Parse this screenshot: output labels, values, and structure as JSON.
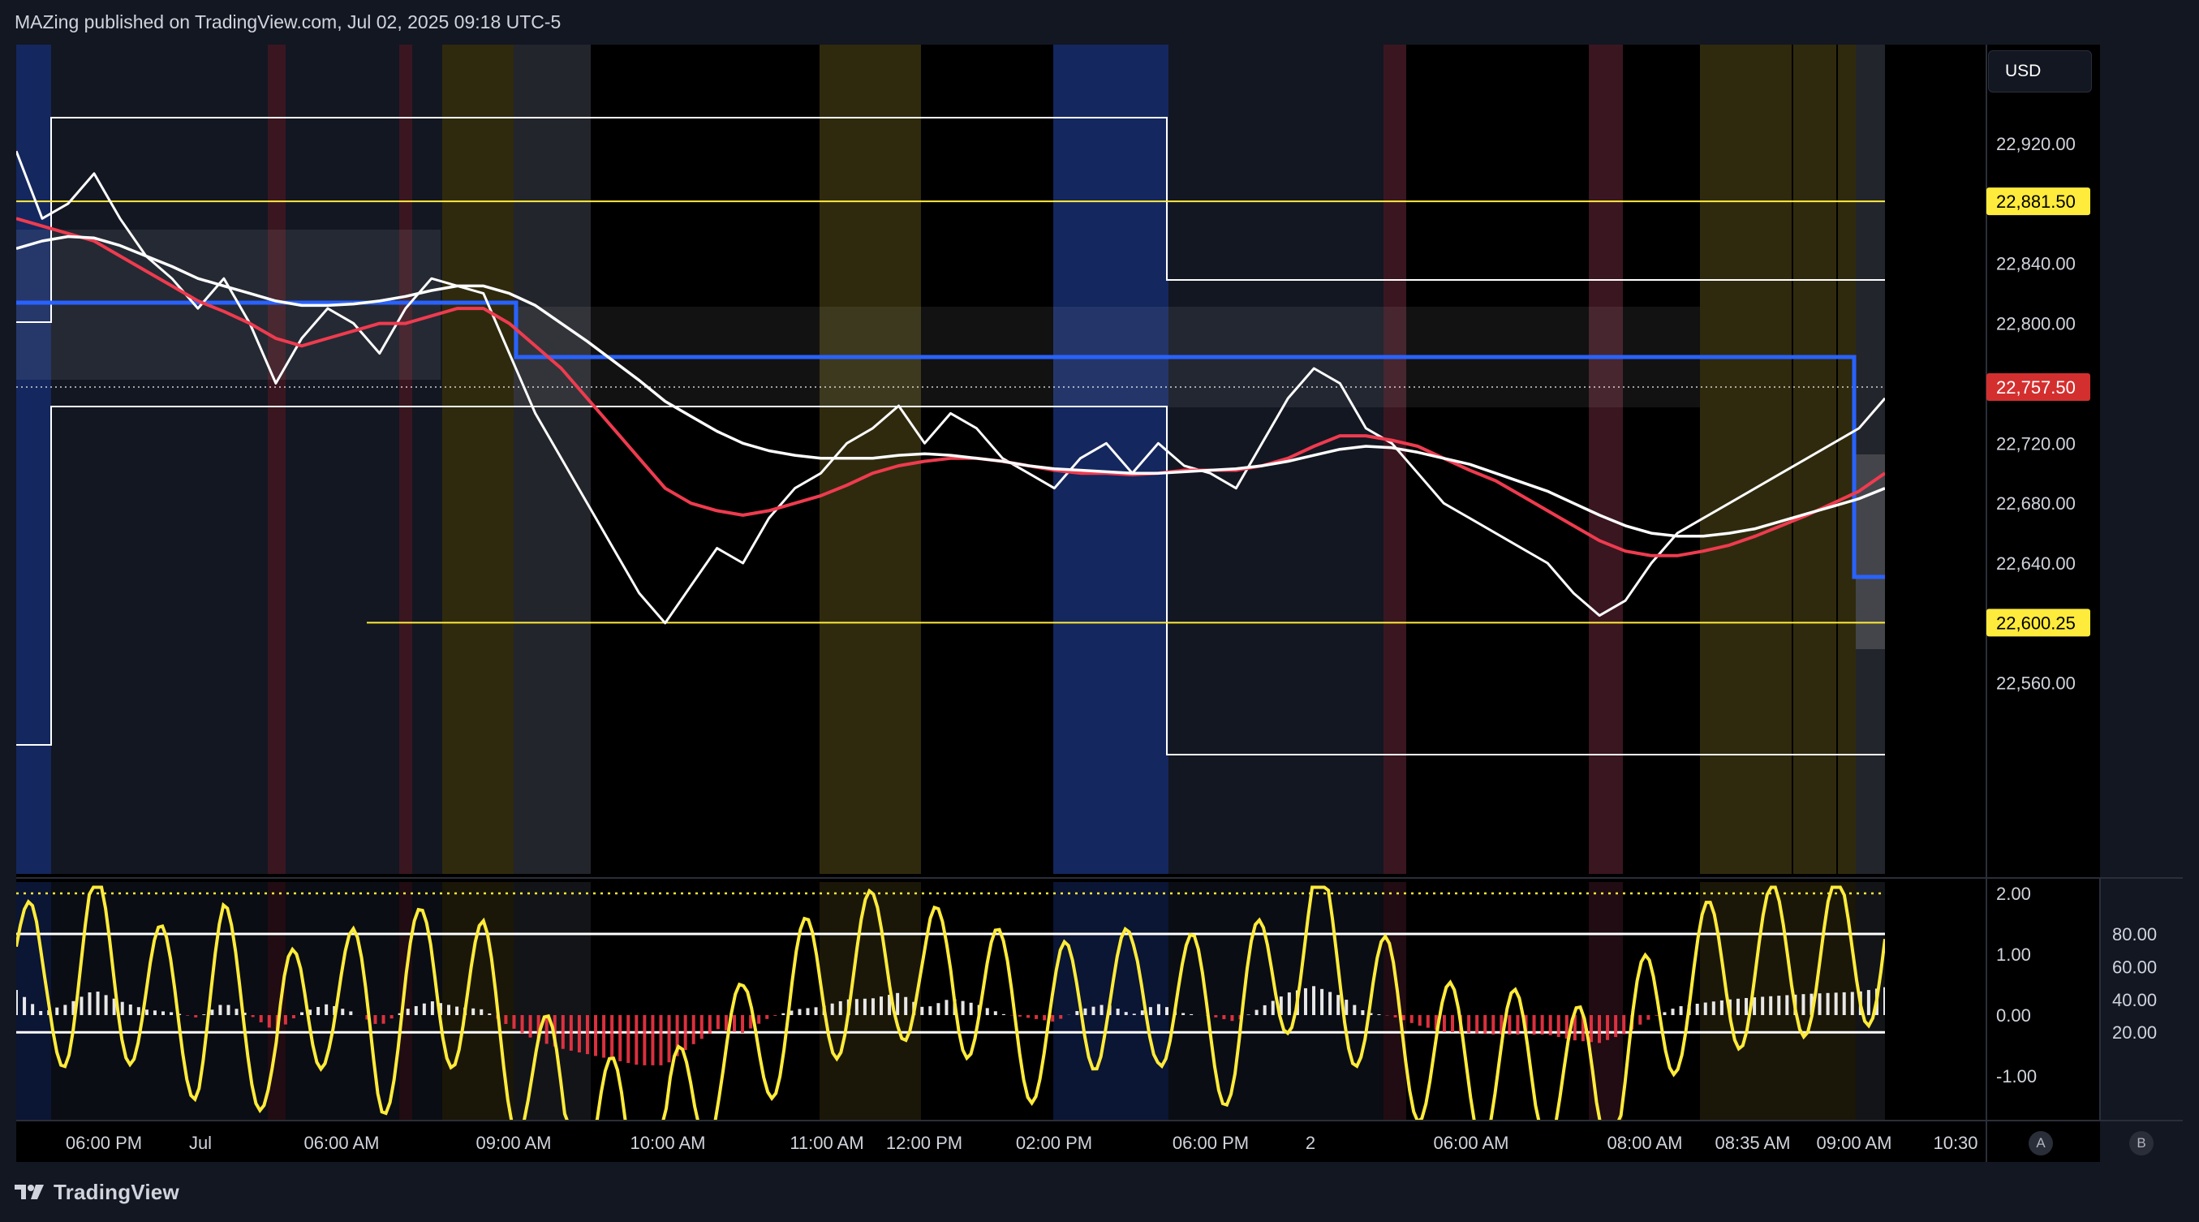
{
  "header": {
    "published_text": "MAZing published on TradingView.com, Jul 02, 2025 09:18 UTC-5"
  },
  "footer": {
    "brand": "TradingView"
  },
  "price_scale": {
    "currency": "USD",
    "ticks": [
      "22,920.00",
      "22,840.00",
      "22,800.00",
      "22,720.00",
      "22,680.00",
      "22,640.00",
      "22,560.00"
    ],
    "tick_values": [
      22920,
      22840,
      22800,
      22720,
      22680,
      22640,
      22560
    ],
    "labels": [
      {
        "text": "22,881.50",
        "value": 22881.5,
        "color": "#ffeb3b",
        "text_color": "#000000"
      },
      {
        "text": "22,757.50",
        "value": 22757.5,
        "color": "#d32f2f",
        "text_color": "#ffffff"
      },
      {
        "text": "22,600.25",
        "value": 22600.25,
        "color": "#ffeb3b",
        "text_color": "#000000"
      }
    ]
  },
  "oscillator_scale": {
    "left_ticks": [
      "2.00",
      "1.00",
      "0.00",
      "-1.00"
    ],
    "left_values": [
      2,
      1,
      0,
      -1
    ],
    "right_ticks": [
      "80.00",
      "60.00",
      "40.00",
      "20.00"
    ],
    "right_values": [
      80,
      60,
      40,
      20
    ]
  },
  "time_axis": {
    "labels": [
      "06:00 PM",
      "Jul",
      "06:00 AM",
      "09:00 AM",
      "10:00 AM",
      "11:00 AM",
      "12:00 PM",
      "02:00 PM",
      "06:00 PM",
      "2",
      "06:00 AM",
      "08:00 AM",
      "08:35 AM",
      "09:00 AM",
      "10:30"
    ]
  },
  "buttons": {
    "a": "A",
    "b": "B"
  },
  "colors": {
    "background": "#000000",
    "ui": "#131722",
    "accent_red": "#f23645",
    "ema_red": "#ef3b4f",
    "blue_line": "#2962ff",
    "yellow": "#ffeb3b",
    "white": "#ffffff"
  },
  "chart_data": {
    "type": "line",
    "title": "",
    "xlabel": "",
    "ylabel": "",
    "ylim": [
      22530,
      22965
    ],
    "series": [
      {
        "values": [
          22915,
          22870,
          22880,
          22900,
          22870,
          22845,
          22830,
          22810,
          22830,
          22800,
          22760,
          22790,
          22810,
          22800,
          22780,
          22810,
          22830,
          22825,
          22820,
          22780,
          22740,
          22710,
          22680,
          22650,
          22620,
          22600,
          22625,
          22650,
          22640,
          22670,
          22690,
          22700,
          22720,
          22730,
          22745,
          22720,
          22740,
          22730,
          22710,
          22700,
          22690,
          22710,
          22720,
          22700,
          22720,
          22705,
          22700,
          22690,
          22720,
          22750,
          22770,
          22760,
          22730,
          22720,
          22700,
          22680,
          22670,
          22660,
          22650,
          22640,
          22620,
          22605,
          22615,
          22640,
          22660,
          22670,
          22680,
          22690,
          22700,
          22710,
          22720,
          22730,
          22750
        ]
      },
      {
        "values": [
          22870,
          22865,
          22860,
          22855,
          22845,
          22835,
          22825,
          22815,
          22808,
          22800,
          22790,
          22785,
          22790,
          22795,
          22800,
          22800,
          22805,
          22810,
          22810,
          22800,
          22785,
          22770,
          22750,
          22730,
          22710,
          22690,
          22680,
          22675,
          22672,
          22675,
          22680,
          22685,
          22692,
          22700,
          22705,
          22708,
          22710,
          22710,
          22708,
          22705,
          22702,
          22700,
          22700,
          22699,
          22700,
          22702,
          22702,
          22702,
          22705,
          22710,
          22718,
          22725,
          22725,
          22722,
          22718,
          22710,
          22702,
          22695,
          22685,
          22675,
          22665,
          22655,
          22648,
          22645,
          22645,
          22648,
          22652,
          22658,
          22665,
          22672,
          22680,
          22688,
          22700
        ]
      },
      {
        "values": [
          22850,
          22855,
          22858,
          22857,
          22852,
          22845,
          22838,
          22830,
          22825,
          22820,
          22815,
          22812,
          22812,
          22813,
          22815,
          22818,
          22822,
          22825,
          22825,
          22820,
          22812,
          22800,
          22788,
          22775,
          22762,
          22748,
          22738,
          22728,
          22720,
          22715,
          22712,
          22710,
          22710,
          22710,
          22712,
          22713,
          22712,
          22710,
          22708,
          22705,
          22703,
          22702,
          22701,
          22700,
          22700,
          22701,
          22702,
          22703,
          22705,
          22708,
          22712,
          22716,
          22718,
          22717,
          22714,
          22710,
          22706,
          22700,
          22694,
          22688,
          22680,
          22672,
          22665,
          22660,
          22658,
          22658,
          22660,
          22663,
          22668,
          22673,
          22678,
          22683,
          22690
        ]
      }
    ]
  }
}
